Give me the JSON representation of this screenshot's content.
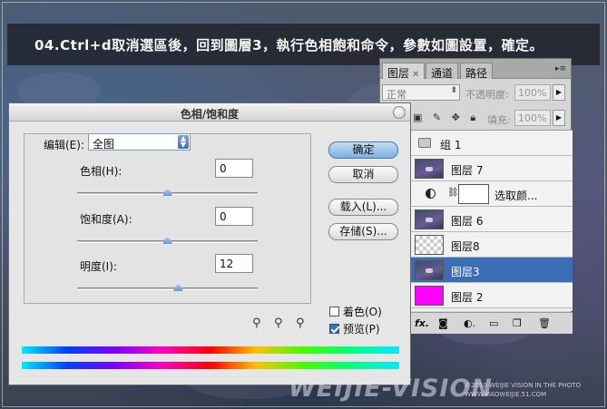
{
  "caption": "04.Ctrl+d取消選區後，回到圖層3，執行色相飽和命令，參數如圖設置，確定。",
  "layers_panel": {
    "tabs": [
      "图层",
      "通道",
      "路径"
    ],
    "blend_mode": "正常",
    "opacity_label": "不透明度:",
    "opacity_value": "100%",
    "fill_label": "填充:",
    "fill_value": "100%",
    "layers": [
      {
        "name": "组 1",
        "thumb": "folder"
      },
      {
        "name": "图层 7",
        "thumb": "photo"
      },
      {
        "name": "选取颜...",
        "thumb": "adjustment"
      },
      {
        "name": "图层 6",
        "thumb": "photo"
      },
      {
        "name": "图层8",
        "thumb": "checker"
      },
      {
        "name": "图层3",
        "thumb": "photo",
        "selected": true
      },
      {
        "name": "图层 2",
        "thumb": "magenta"
      }
    ],
    "footer_icons": [
      "fx",
      "mask",
      "adjustment",
      "folder",
      "new-layer",
      "trash"
    ]
  },
  "dialog": {
    "title": "色相/饱和度",
    "edit_label": "编辑(E):",
    "edit_value": "全图",
    "hue_label": "色相(H):",
    "hue_value": "0",
    "saturation_label": "饱和度(A):",
    "saturation_value": "0",
    "lightness_label": "明度(I):",
    "lightness_value": "12",
    "slider_levels": {
      "hue": 0.5,
      "saturation": 0.5,
      "lightness": 0.56
    },
    "buttons": {
      "ok": "确定",
      "cancel": "取消",
      "load": "载入(L)...",
      "save": "存储(S)..."
    },
    "colorize_label": "着色(O)",
    "colorize_checked": false,
    "preview_label": "预览(P)",
    "preview_checked": true
  },
  "watermark": {
    "logo": "WEIJIE-VISION",
    "copyright": "©2010 WEIJIE VISION IN THE PHOTO",
    "url": "WWW.MAOWEIJIE.51.COM"
  }
}
